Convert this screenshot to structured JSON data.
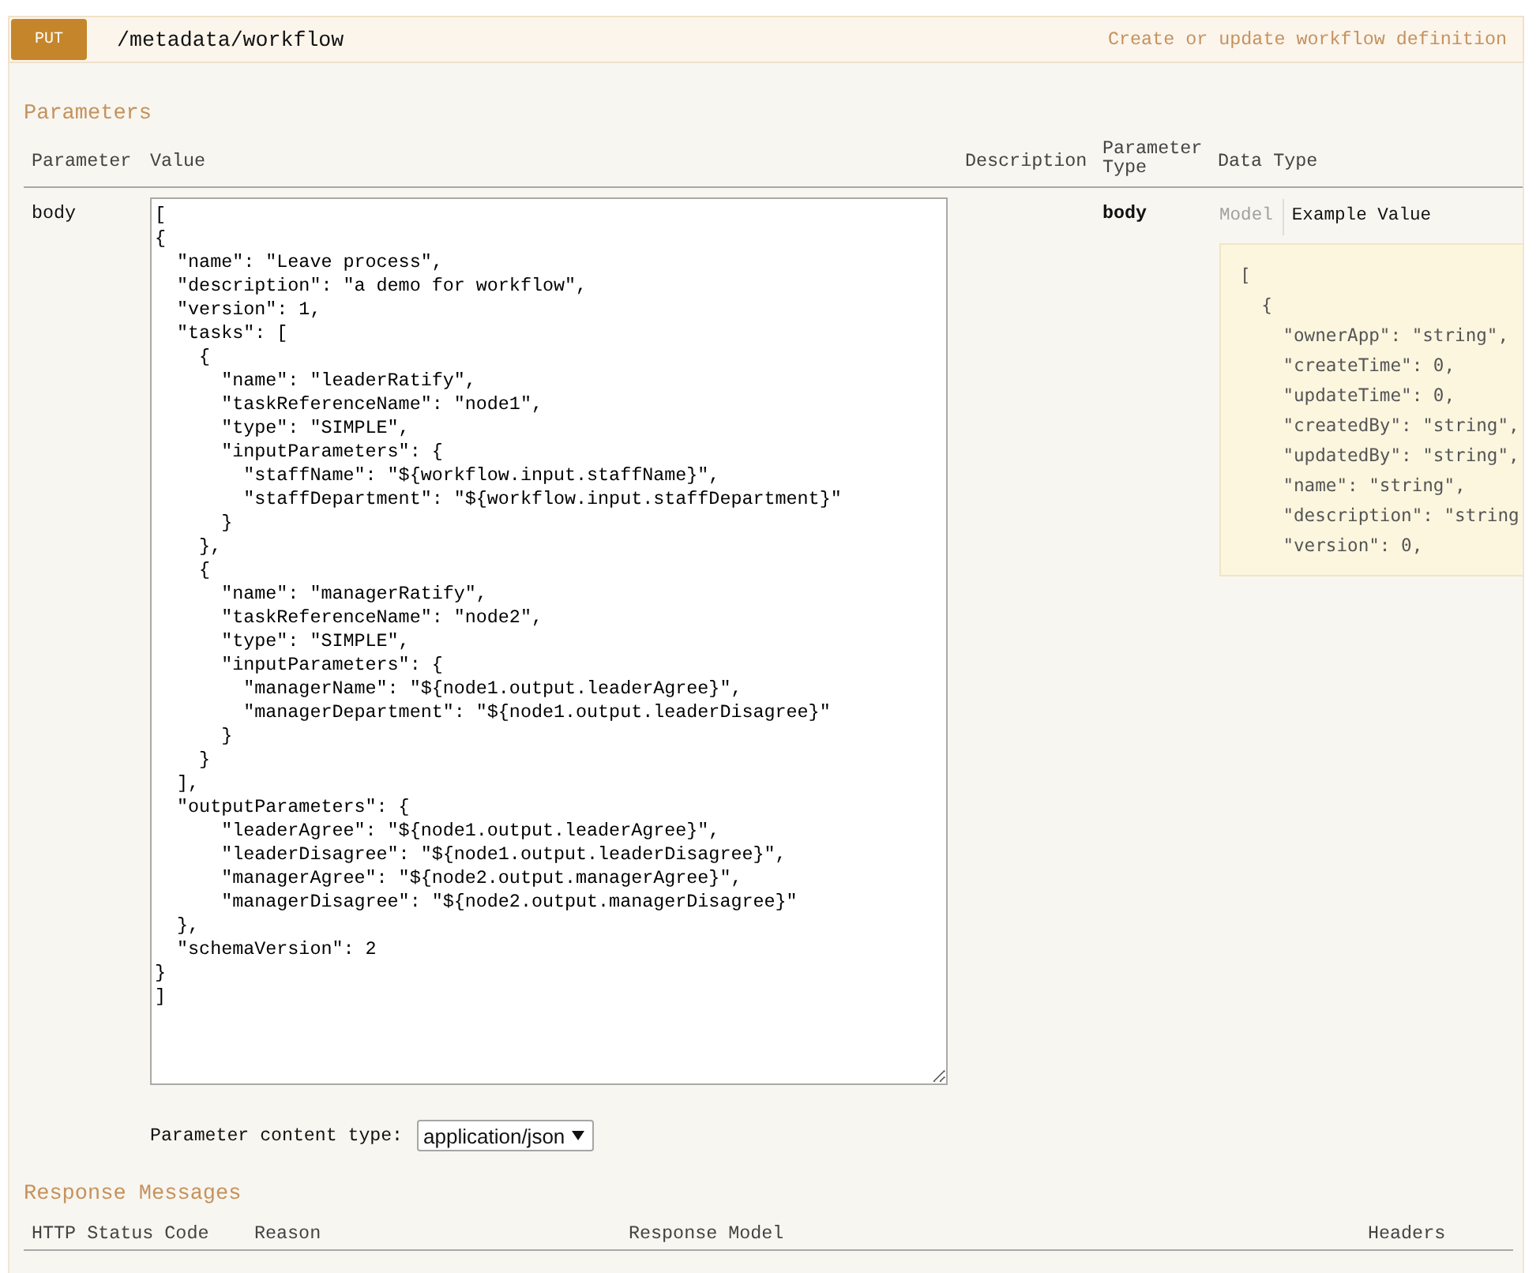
{
  "operation": {
    "method": "PUT",
    "path": "/metadata/workflow",
    "summary": "Create or update workflow definition"
  },
  "parameters": {
    "title": "Parameters",
    "columns": [
      "Parameter",
      "Value",
      "Description",
      "Parameter Type",
      "Data Type"
    ],
    "rows": [
      {
        "parameter": "body",
        "value_lines": [
          "[",
          "{",
          "  \"name\": \"Leave process\",",
          "  \"description\": \"a demo for workflow\",",
          "  \"version\": 1,",
          "  \"tasks\": [",
          "    {",
          "      \"name\": \"leaderRatify\",",
          "      \"taskReferenceName\": \"node1\",",
          "      \"type\": \"SIMPLE\",",
          "      \"inputParameters\": {",
          "        \"staffName\": \"${workflow.input.staffName}\",",
          "        \"staffDepartment\": \"${workflow.input.staffDepartment}\"",
          "      }",
          "    },",
          "    {",
          "      \"name\": \"managerRatify\",",
          "      \"taskReferenceName\": \"node2\",",
          "      \"type\": \"SIMPLE\",",
          "      \"inputParameters\": {",
          "        \"managerName\": \"${node1.output.leaderAgree}\",",
          "        \"managerDepartment\": \"${node1.output.leaderDisagree}\"",
          "      }",
          "    }",
          "  ],",
          "  \"outputParameters\": {",
          "      \"leaderAgree\": \"${node1.output.leaderAgree}\",",
          "      \"leaderDisagree\": \"${node1.output.leaderDisagree}\",",
          "      \"managerAgree\": \"${node2.output.managerAgree}\",",
          "      \"managerDisagree\": \"${node2.output.managerDisagree}\"",
          "  },",
          "  \"schemaVersion\": 2",
          "}",
          "]"
        ],
        "parameter_type": "body",
        "data_type": {
          "tabs": [
            {
              "label": "Model",
              "selected": false
            },
            {
              "label": "Example Value",
              "selected": true
            }
          ],
          "example_lines": [
            "[",
            "  {",
            "    \"ownerApp\": \"string\",",
            "    \"createTime\": 0,",
            "    \"updateTime\": 0,",
            "    \"createdBy\": \"string\",",
            "    \"updatedBy\": \"string\",",
            "    \"name\": \"string\",",
            "    \"description\": \"string",
            "    \"version\": 0,"
          ]
        }
      }
    ],
    "content_type": {
      "label": "Parameter content type:",
      "value": "application/json"
    }
  },
  "responses": {
    "title": "Response Messages",
    "columns": [
      "HTTP Status Code",
      "Reason",
      "Response Model",
      "Headers"
    ]
  }
}
